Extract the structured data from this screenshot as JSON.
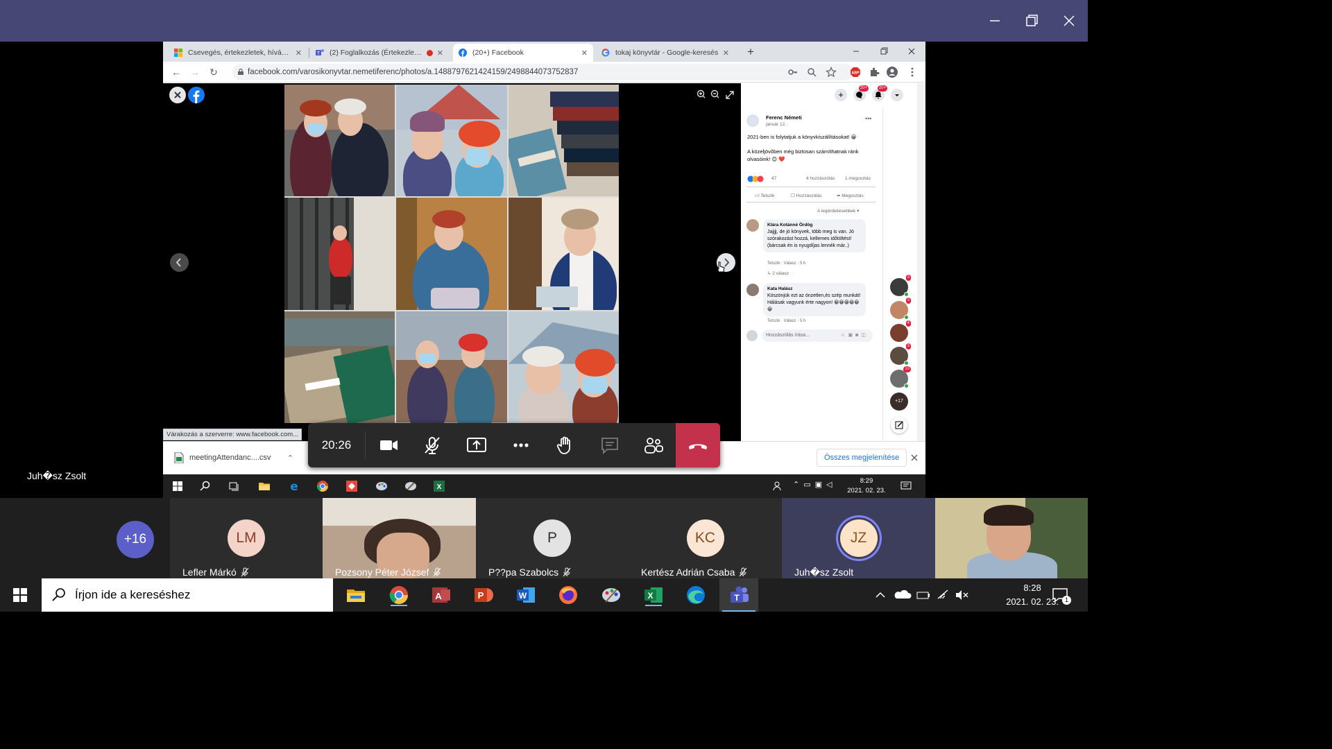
{
  "teams": {
    "presenter_name": "Juh�sz Zsolt",
    "call_timer": "20:26",
    "overflow_count": "+16",
    "participants": [
      {
        "name": "Lefler Márkó",
        "initials": "LM",
        "mic_off": true,
        "avatar_bg": "#f4d3c8",
        "avatar_fg": "#8d3b2e"
      },
      {
        "name": "Pozsony Péter József",
        "initials": "",
        "mic_off": true,
        "video": true
      },
      {
        "name": "P??pa Szabolcs",
        "initials": "P",
        "mic_off": true,
        "avatar_bg": "#e3e3e3",
        "avatar_fg": "#333333"
      },
      {
        "name": "Kertész Adrián Csaba",
        "initials": "KC",
        "mic_off": true,
        "avatar_bg": "#fbe6d5",
        "avatar_fg": "#8a4a1e"
      },
      {
        "name": "Juh�sz Zsolt",
        "initials": "JZ",
        "mic_off": false,
        "speaking": true,
        "avatar_bg": "#fde4c8",
        "avatar_fg": "#8a5a1e"
      }
    ]
  },
  "browser": {
    "tabs": [
      {
        "title": "Csevegés, értekezletek, hívás, e",
        "icon": "microsoft-icon",
        "active": false
      },
      {
        "title": "(2) Foglalkozás (Értekezlet) |",
        "icon": "teams-icon",
        "active": false,
        "recording": true
      },
      {
        "title": "(20+) Facebook",
        "icon": "facebook-icon",
        "active": true
      },
      {
        "title": "tokaj könyvtár - Google-keresés",
        "icon": "google-icon",
        "active": false
      }
    ],
    "url": "facebook.com/varosikonyvtar.nemetiferenc/photos/a.1488797621424159/2498844073752837",
    "status_text": "Várakozás a szerverre: www.facebook.com...",
    "download": {
      "file": "meetingAttendanc....csv",
      "show_all": "Összes megjelenítése"
    }
  },
  "facebook": {
    "badges": {
      "messenger": "20+",
      "notifications": "20+"
    },
    "post": {
      "author": "Ferenc Németi",
      "date": "január 12. · ",
      "text1": "2021-ben is folytatjuk a könyvkiszállításokat! 😀",
      "text2": "A közeljövőben még biztosan számíthatnak ránk olvasóink! 😊 ❤️",
      "reactions_count": "47",
      "comments_count": "4 hozzászólás",
      "shares_count": "1 megosztás",
      "like": "Tetszik",
      "comment": "Hozzászólás",
      "share": "Megosztás",
      "sort": "A legérdekesebbek ▾"
    },
    "comments": [
      {
        "author": "Klára Kotánné Ördög",
        "text": "Jajjjj, de jó könyvek, több meg is van. Jó szórakozást hozzá, kellemes időtöltést! (bárcsak én is nyugdíjas lennék már..)",
        "meta": "Tetszik · Válasz · 5 h",
        "replies": "2 válasz"
      },
      {
        "author": "Kata Halász",
        "text": "Köszönjük ezt az önzetlen,és szép munkát! Hálásak vagyunk érte nagyon! 😀😀😀😀😀😀",
        "meta": "Tetszik · Válasz · 5 h"
      }
    ],
    "composer_placeholder": "Hozzászólás írása...",
    "chat_badges": [
      "3",
      "3",
      "4",
      "3",
      "10"
    ],
    "more_contacts": "+17"
  },
  "inner_taskbar": {
    "time": "8:29",
    "date": "2021. 02. 23."
  },
  "taskbar": {
    "search_placeholder": "Írjon ide a kereséshez",
    "time": "8:28",
    "date": "2021. 02. 23.",
    "notification_count": "1"
  }
}
